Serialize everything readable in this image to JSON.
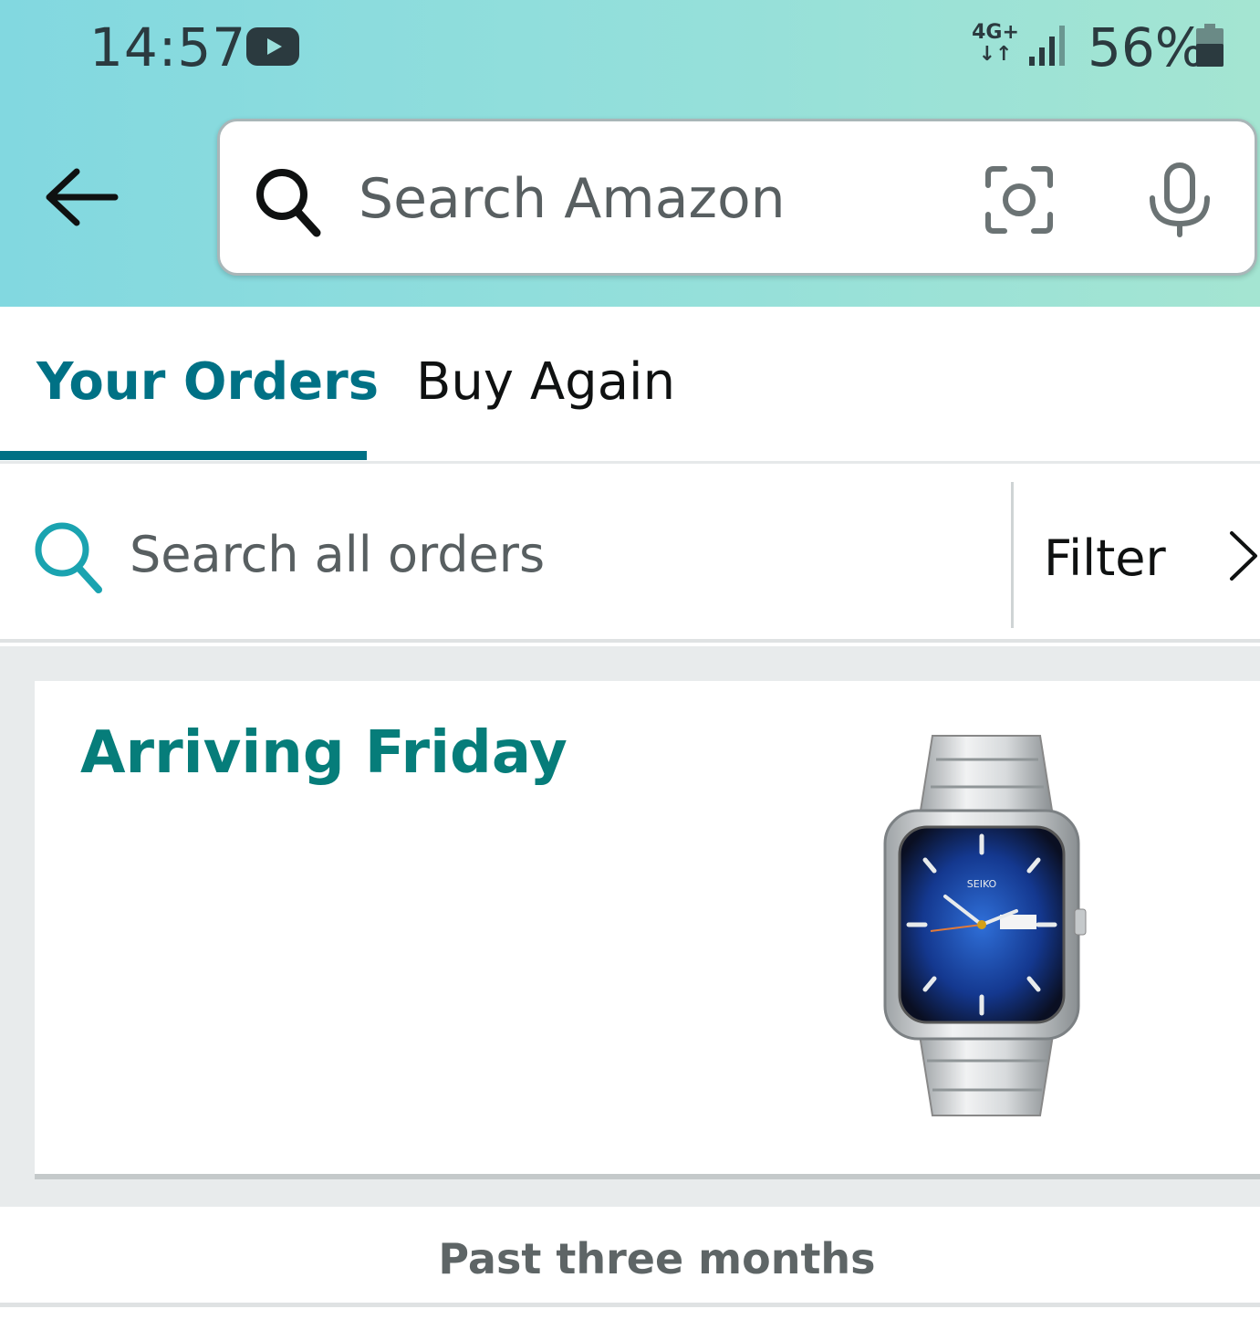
{
  "status_bar": {
    "time": "14:57",
    "network": "4G+",
    "battery": "56%",
    "icons": [
      "youtube-icon",
      "data-arrows-icon",
      "signal-icon",
      "battery-icon"
    ]
  },
  "header": {
    "search_placeholder": "Search Amazon",
    "icons": [
      "back-arrow-icon",
      "search-icon",
      "camera-icon",
      "mic-icon"
    ]
  },
  "tabs": [
    {
      "label": "Your Orders",
      "active": true
    },
    {
      "label": "Buy Again",
      "active": false
    }
  ],
  "order_search": {
    "placeholder": "Search all orders",
    "filter_label": "Filter"
  },
  "orders": [
    {
      "status": "Arriving Friday",
      "product_image": "silver-watch-blue-dial"
    }
  ],
  "section": {
    "title": "Past three months"
  },
  "colors": {
    "accent": "#007185",
    "status_green": "#067d7a",
    "header_gradient_start": "#82d8e0",
    "header_gradient_end": "#a4e5d2"
  }
}
